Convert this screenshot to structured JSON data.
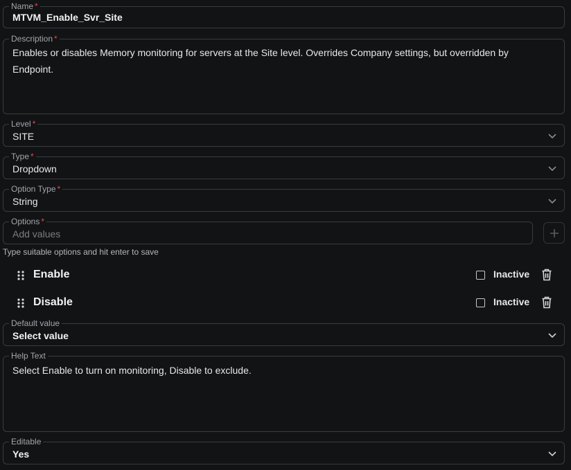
{
  "name": {
    "label": "Name",
    "required": "*",
    "value": "MTVM_Enable_Svr_Site"
  },
  "description": {
    "label": "Description",
    "required": "*",
    "value": "Enables or disables Memory monitoring for servers at the Site level. Overrides Company settings, but overridden by Endpoint."
  },
  "level": {
    "label": "Level",
    "required": "*",
    "value": "SITE"
  },
  "type": {
    "label": "Type",
    "required": "*",
    "value": "Dropdown"
  },
  "option_type": {
    "label": "Option Type",
    "required": "*",
    "value": "String"
  },
  "options": {
    "label": "Options",
    "required": "*",
    "placeholder": "Add values",
    "hint": "Type suitable options and hit enter to save",
    "items": [
      {
        "label": "Enable",
        "inactive_label": "Inactive"
      },
      {
        "label": "Disable",
        "inactive_label": "Inactive"
      }
    ]
  },
  "default_value": {
    "label": "Default value",
    "value": "Select value"
  },
  "help_text": {
    "label": "Help Text",
    "value": "Select Enable to turn on monitoring, Disable to exclude."
  },
  "editable": {
    "label": "Editable",
    "value": "Yes"
  },
  "colors": {
    "background": "#121315",
    "border": "#3a3c40",
    "required": "#e5484d"
  },
  "icons": {
    "dropdown": "chevron-down-icon",
    "add": "plus-icon",
    "drag": "drag-handle-icon",
    "delete": "trash-icon"
  }
}
